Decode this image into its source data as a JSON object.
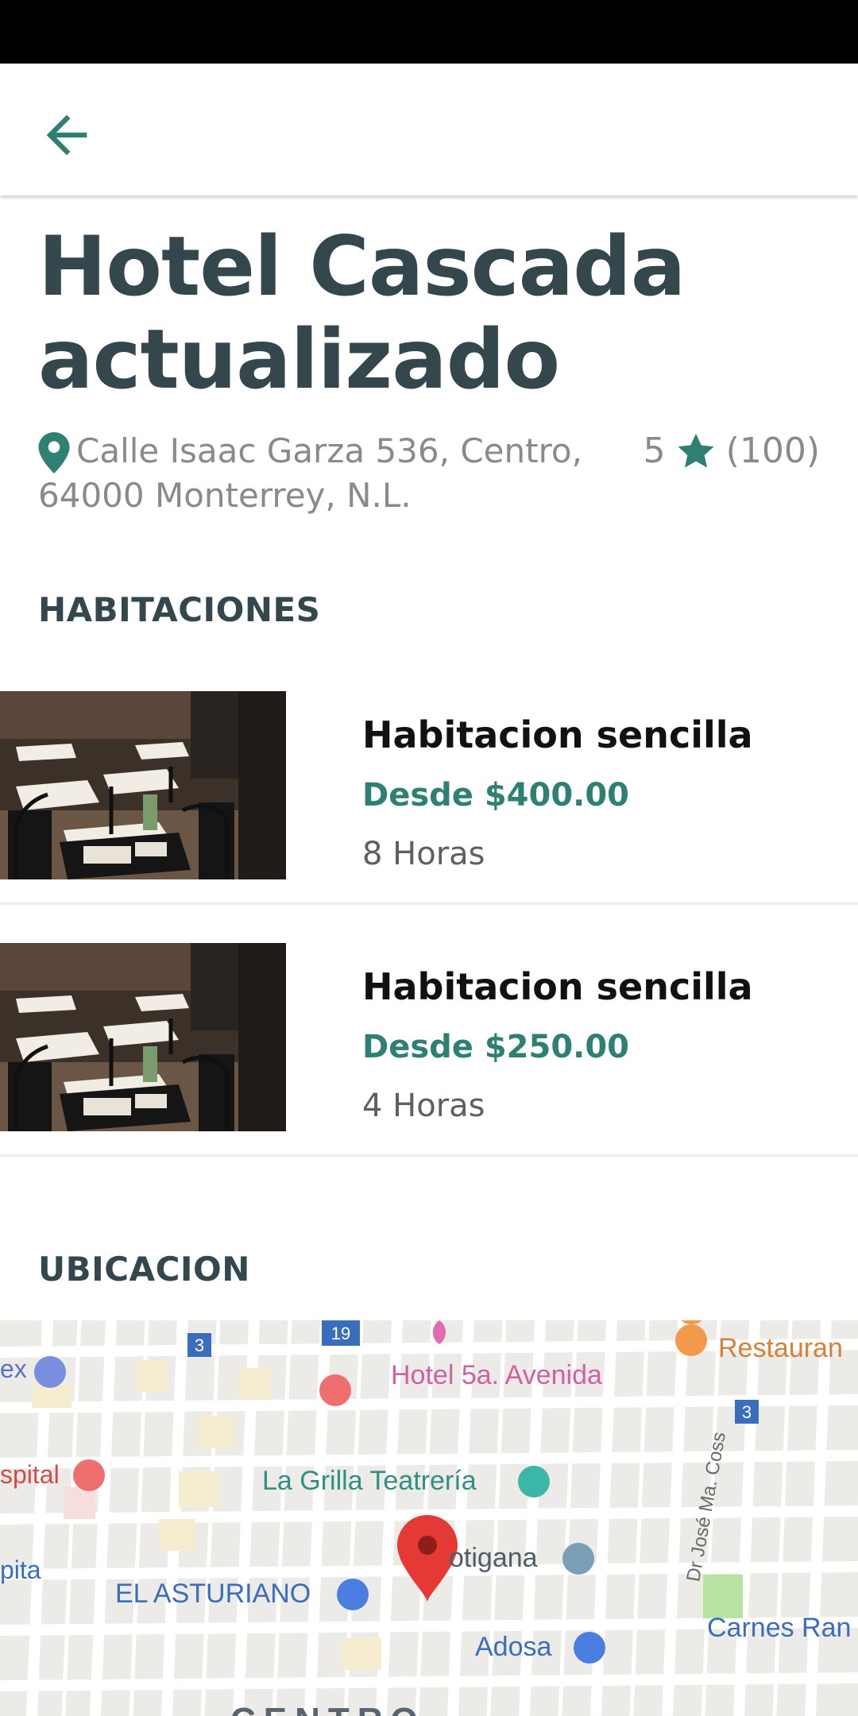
{
  "hotel": {
    "title": "Hotel Cascada actualizado",
    "address": "Calle Isaac Garza 536, Centro, 64000 Monterrey, N.L.",
    "rating": "5",
    "reviews": "(100)"
  },
  "sections": {
    "rooms": "HABITACIONES",
    "location": "UBICACION"
  },
  "rooms": [
    {
      "name": "Habitacion sencilla",
      "price": "Desde $400.00",
      "duration": "8 Horas"
    },
    {
      "name": "Habitacion sencilla",
      "price": "Desde $250.00",
      "duration": "4 Horas"
    }
  ],
  "map": {
    "labels": {
      "hotel": "Hotel 5a. Avenida",
      "restaurant": "Restauran",
      "grilla": "La Grilla Teatrería",
      "otigana": "otigana",
      "asturiano": "EL ASTURIANO",
      "adosa": "Adosa",
      "carnes": "Carnes Ran",
      "street": "Dr José Ma. Coss",
      "ex": "ex",
      "spital": "spital",
      "pita": "pita",
      "centro": "CENTRO",
      "shield_3a": "3",
      "shield_19": "19",
      "shield_3b": "3"
    }
  },
  "colors": {
    "accent": "#2e8072",
    "title": "#34474d",
    "muted": "#8a8a8a",
    "map_pin": "#e53935"
  }
}
